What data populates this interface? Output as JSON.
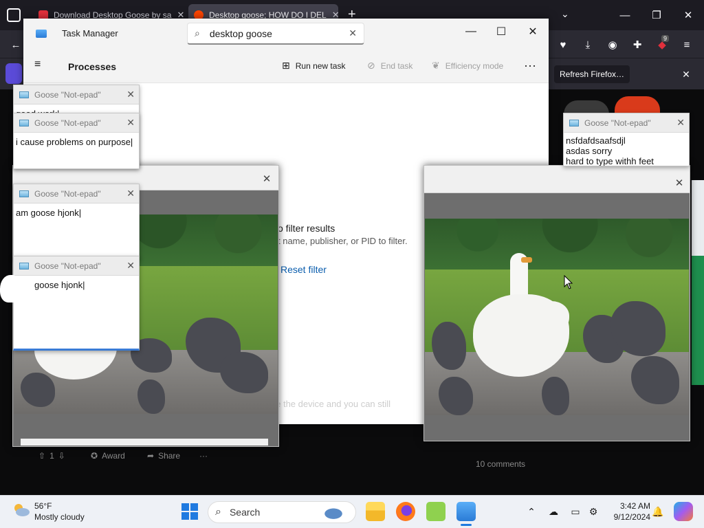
{
  "firefox": {
    "tabs": [
      {
        "label": "Download Desktop Goose by sa",
        "favicon_color": "#e4303c"
      },
      {
        "label": "Desktop goose; HOW DO I DEL",
        "favicon_color": "#ff4500"
      }
    ],
    "new_tab_label": "+",
    "extensions_badge": "9",
    "notification": {
      "button": "Refresh Firefox…"
    }
  },
  "task_manager": {
    "title": "Task Manager",
    "search_value": "desktop goose",
    "section": "Processes",
    "actions": {
      "run_new_task": "Run new task",
      "end_task": "End task",
      "efficiency_mode": "Efficiency mode"
    },
    "empty_state": {
      "title_fragment": "o filter results",
      "hint_fragment": "t name, publisher, or PID to filter.",
      "reset": "Reset filter"
    },
    "background_text": "close the device and you can still"
  },
  "reddit": {
    "votes": "1",
    "award": "Award",
    "share": "Share",
    "more": "···",
    "comments": "10 comments"
  },
  "notes": [
    {
      "title": "Goose \"Not-epad\"",
      "text": "good work|"
    },
    {
      "title": "Goose \"Not-epad\"",
      "text": "i cause problems on purpose|"
    },
    {
      "title": "Goose \"Not-epad\"",
      "text": "am goose hjonk|"
    },
    {
      "title": "Goose \"Not-epad\"",
      "text": "goose hjonk|"
    },
    {
      "title": "Goose \"Not-epad\"",
      "text": "nsfdafdsaafsdjl\nasdas      sorry\nhard to type withh feet"
    }
  ],
  "taskbar": {
    "weather_temp": "56°F",
    "weather_desc": "Mostly cloudy",
    "search_placeholder": "Search",
    "time": "3:42 AM",
    "date": "9/12/2024"
  },
  "colors": {
    "accent_blue": "#0a5dad",
    "firefox_dark": "#1c1b22",
    "taskbar": "#eef1f6"
  }
}
